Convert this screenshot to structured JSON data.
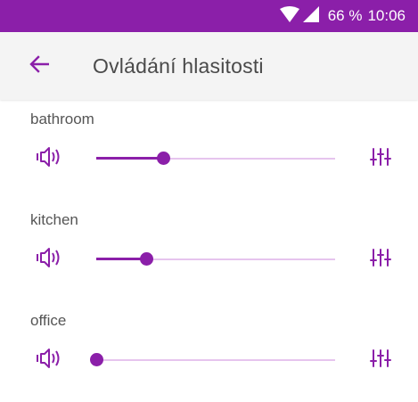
{
  "colors": {
    "accent": "#8b1fa9",
    "status_bar": "#8b1fa9",
    "app_bar": "#f4f4f4",
    "track": "#e6c4ee"
  },
  "status_bar": {
    "battery": "66 %",
    "time": "10:06",
    "icons": [
      "wifi-icon",
      "signal-icon"
    ]
  },
  "header": {
    "back_icon": "arrow-left-icon",
    "title": "Ovládání hlasitosti"
  },
  "zones": [
    {
      "name": "bathroom",
      "volume": 0.28
    },
    {
      "name": "kitchen",
      "volume": 0.21
    },
    {
      "name": "office",
      "volume": 0.0
    }
  ],
  "zone_icons": {
    "speaker": "speaker-icon",
    "equalizer": "equalizer-icon"
  }
}
